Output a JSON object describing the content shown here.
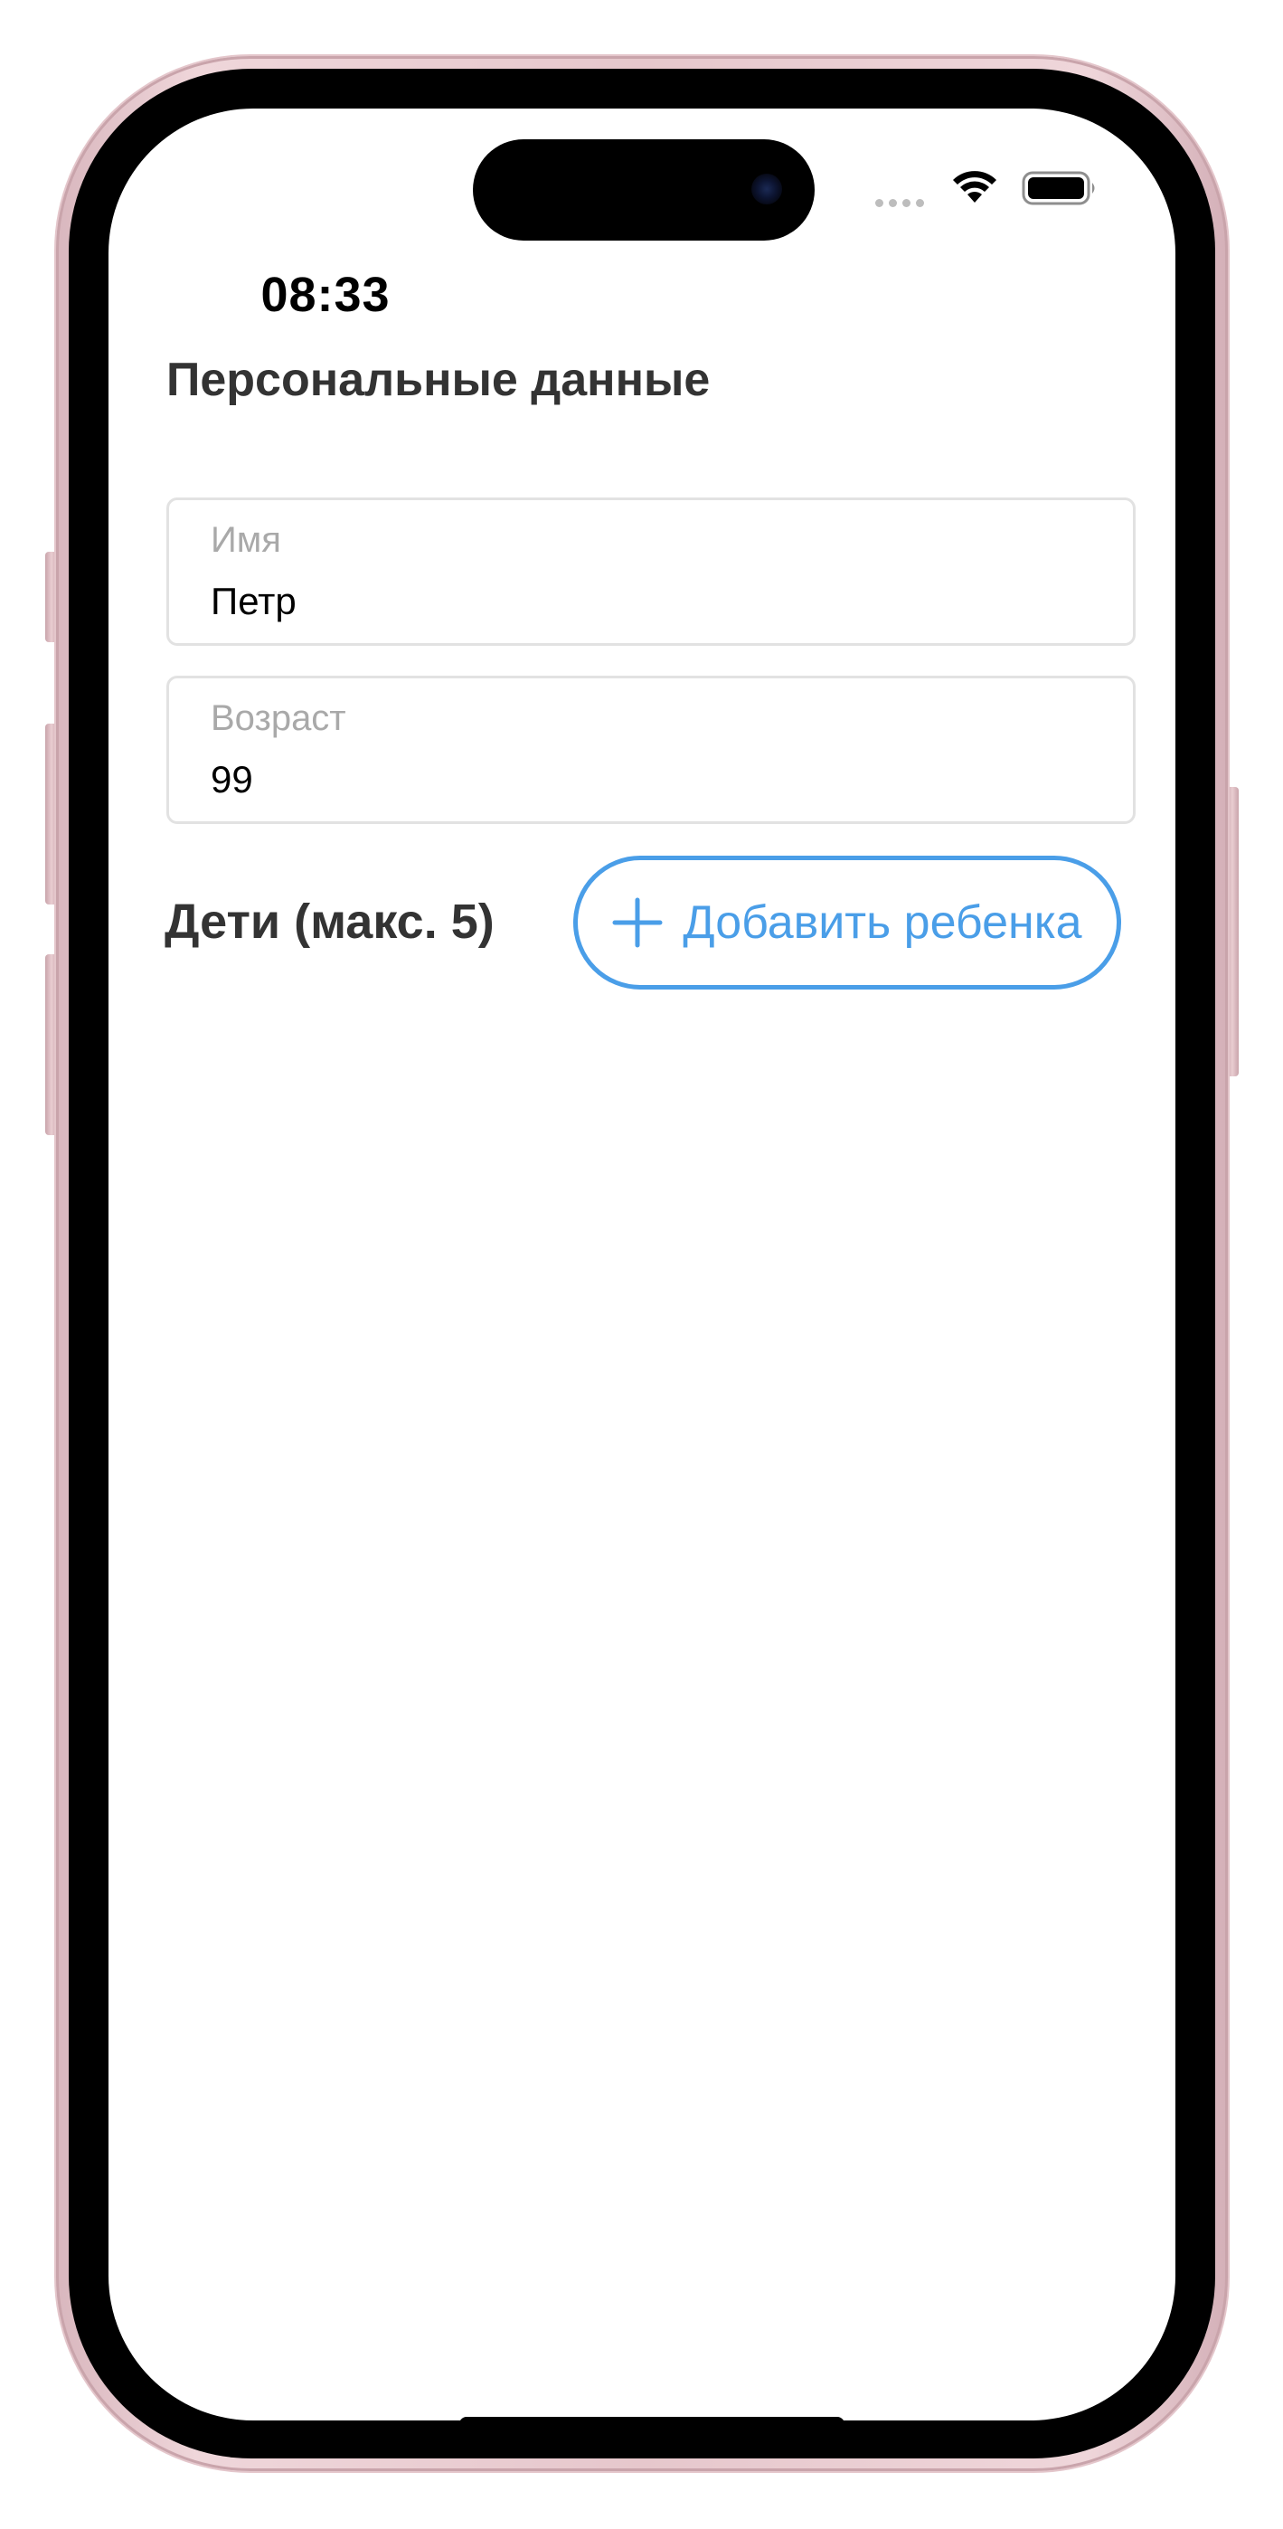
{
  "status_bar": {
    "time": "08:33",
    "wifi_icon": "wifi-icon",
    "battery_icon": "battery-icon"
  },
  "form": {
    "title": "Персональные данные",
    "name_field": {
      "label": "Имя",
      "value": "Петр"
    },
    "age_field": {
      "label": "Возраст",
      "value": "99"
    }
  },
  "children": {
    "title": "Дети (макс. 5)",
    "add_button_label": "Добавить ребенка",
    "add_button_icon": "plus-icon"
  },
  "colors": {
    "accent": "#4a9ee8",
    "heading": "#333333",
    "placeholder": "#a9a9a9",
    "field_border": "#e2e2e2",
    "frame": "#e6c7cc"
  }
}
